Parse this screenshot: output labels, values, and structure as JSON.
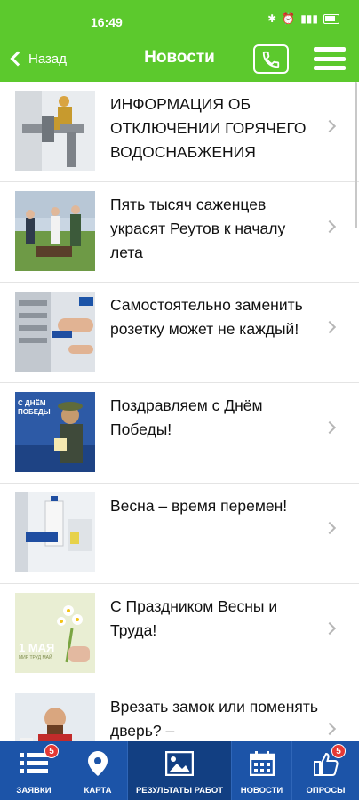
{
  "status_bar": {
    "time": "16:49"
  },
  "header": {
    "back_label": "Назад",
    "title": "Новости"
  },
  "news": [
    {
      "title": "ИНФОРМАЦИЯ ОБ ОТКЛЮЧЕНИИ ГОРЯЧЕГО ВОДОСНАБЖЕНИЯ"
    },
    {
      "title": "Пять тысяч саженцев украсят Реутов к началу лета"
    },
    {
      "title": "Самостоятельно заменить розетку может не каждый!"
    },
    {
      "title": "Поздравляем с Днём Победы!",
      "thumb_text": "С ДНЁМ ПОБЕДЫ"
    },
    {
      "title": "Весна – время перемен!"
    },
    {
      "title": "С Праздником Весны и Труда!",
      "thumb_text": "1 МАЯ",
      "thumb_subtext": "МИР ТРУД МАЙ"
    },
    {
      "title": "Врезать замок или поменять дверь? –"
    }
  ],
  "tabs": [
    {
      "label": "ЗАЯВКИ",
      "icon": "list-icon",
      "badge": "5"
    },
    {
      "label": "КАРТА",
      "icon": "map-pin-icon"
    },
    {
      "label": "РЕЗУЛЬТАТЫ РАБОТ",
      "icon": "image-icon",
      "active": true
    },
    {
      "label": "НОВОСТИ",
      "icon": "calendar-icon"
    },
    {
      "label": "ОПРОСЫ",
      "icon": "thumbs-up-icon",
      "badge": "5"
    }
  ],
  "colors": {
    "header_green": "#5cc92d",
    "tabbar_blue": "#1c54a8",
    "badge_red": "#e53935"
  }
}
